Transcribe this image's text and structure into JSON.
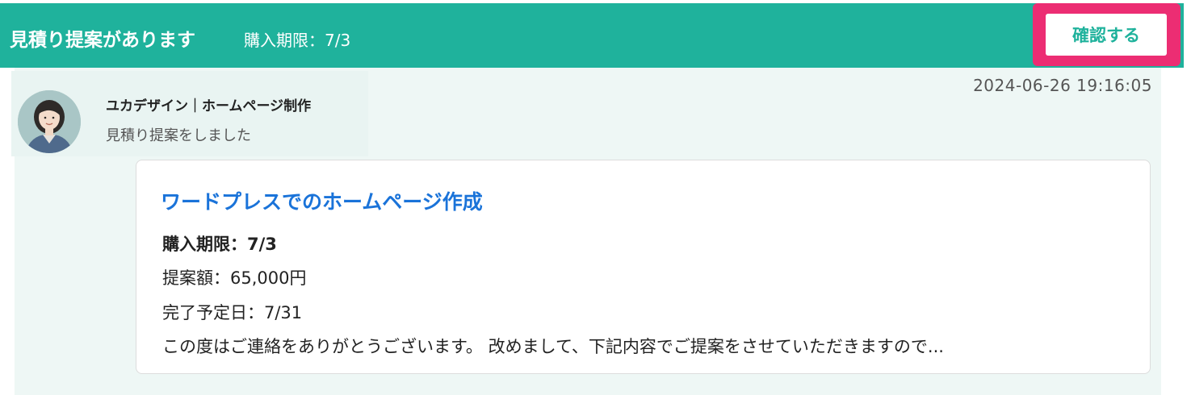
{
  "header": {
    "title": "見積り提案があります",
    "deadline": "購入期限：7/3",
    "confirm_label": "確認する"
  },
  "sender": {
    "name": "ユカデザイン｜ホームページ制作",
    "action": "見積り提案をしました",
    "timestamp": "2024-06-26 19:16:05"
  },
  "proposal": {
    "title": "ワードプレスでのホームページ作成",
    "deadline_label": "購入期限：",
    "deadline_value": "7/3",
    "price": "提案額：65,000円",
    "completion": "完了予定日：7/31",
    "message": "この度はご連絡をありがとうございます。 改めまして、下記内容でご提案をさせていただきますので..."
  },
  "colors": {
    "header_bg": "#1fb29c",
    "highlight": "#ec2d73",
    "link_blue": "#1a73d9",
    "panel_bg": "#eef7f5"
  }
}
